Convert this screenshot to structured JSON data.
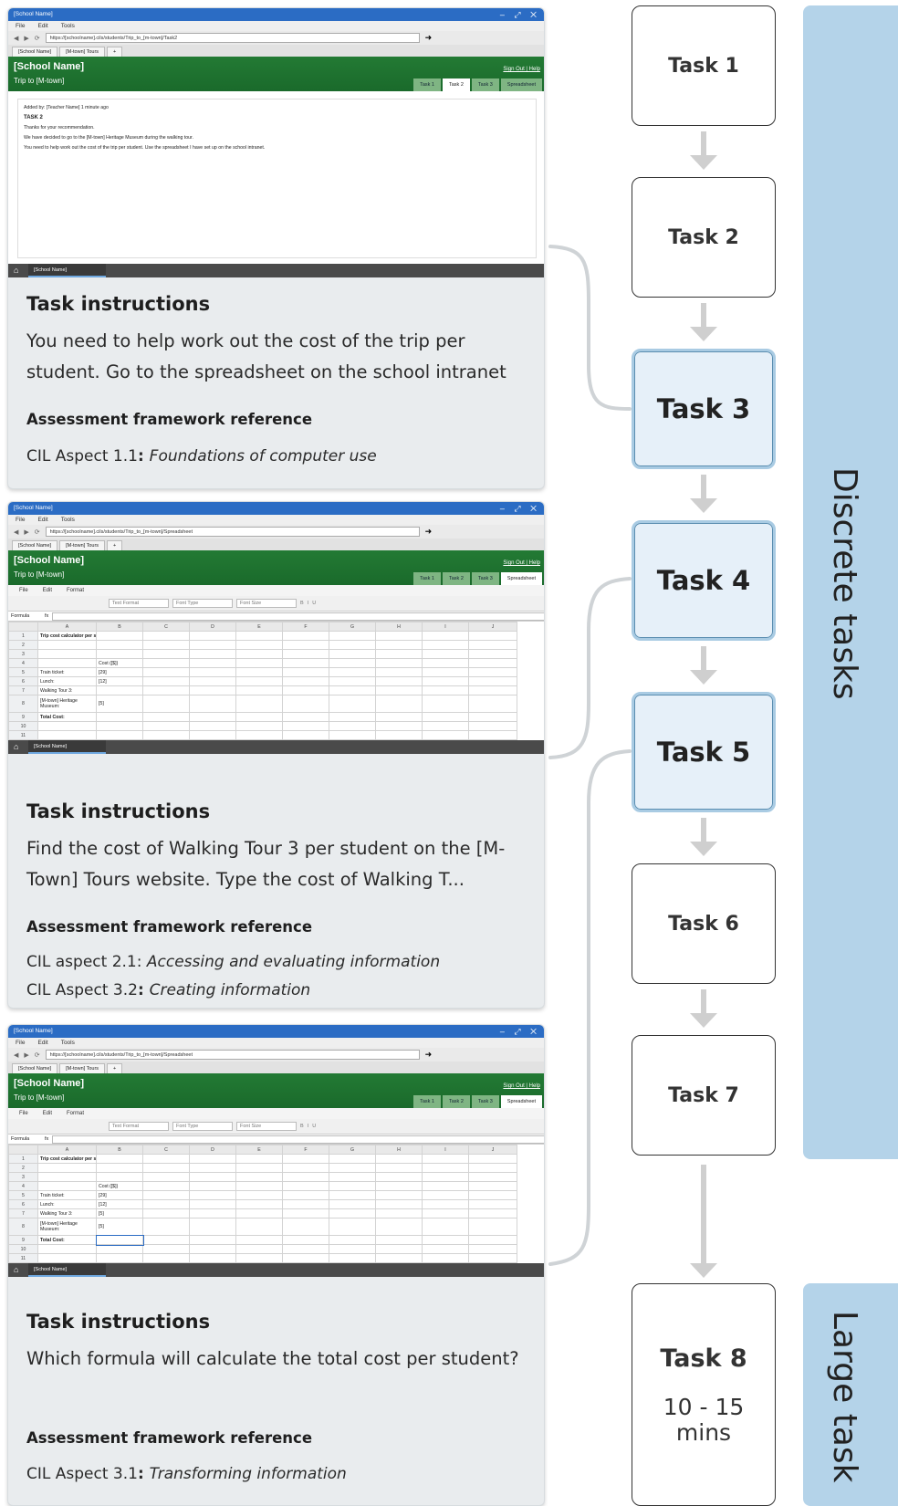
{
  "browser": {
    "window_title": "[School Name]",
    "window_controls": "– ⤢ ✕",
    "menu": [
      "File",
      "Edit",
      "Tools"
    ],
    "url_task2": "https://[schoolname].cils/students/Trip_to_[m-town]/Task2",
    "url_sheet": "https://[schoolname].cils/students/Trip_to_[m-town]/Spreadsheet",
    "tabs": [
      "[School Name]",
      "[M-town] Tours",
      "+"
    ],
    "bottom_tab": "[School Name]"
  },
  "site": {
    "name": "[School Name]",
    "page": "Trip to [M-town]",
    "signout": "Sign Out | Help",
    "tabs": [
      "Task 1",
      "Task 2",
      "Task 3",
      "Spreadsheet"
    ]
  },
  "message": {
    "added": "Added by: [Teacher Name] 1 minute ago",
    "title": "TASK 2",
    "lines": [
      "Thanks for your recommendation.",
      "We have decided to go to the [M-town] Heritage Museum during the walking tour.",
      "You need to help work out the cost of the trip per student. Use the spreadsheet I have set up on the school intranet."
    ]
  },
  "sheet": {
    "menu": [
      "File",
      "Edit",
      "Format"
    ],
    "dropdowns": [
      "Text Format",
      "Font Type",
      "Font Size"
    ],
    "formula_label": "Formula",
    "fx": "fx",
    "columns": [
      "",
      "A",
      "B",
      "C",
      "D",
      "E",
      "F",
      "G",
      "H",
      "I",
      "J"
    ],
    "rows_card2": [
      [
        "1",
        "Trip cost calculator per student",
        ""
      ],
      [
        "2",
        "",
        ""
      ],
      [
        "3",
        "",
        ""
      ],
      [
        "4",
        "",
        "Cost ([$])"
      ],
      [
        "5",
        "Train ticket:",
        "[29]"
      ],
      [
        "6",
        "Lunch:",
        "[12]"
      ],
      [
        "7",
        "Walking Tour 3:",
        ""
      ],
      [
        "8",
        "[M-town] Heritage Museum:",
        "[5]"
      ],
      [
        "9",
        "Total Cost:",
        ""
      ],
      [
        "10",
        "",
        ""
      ],
      [
        "11",
        "",
        ""
      ]
    ],
    "rows_card3": [
      [
        "1",
        "Trip cost calculator per student",
        ""
      ],
      [
        "2",
        "",
        ""
      ],
      [
        "3",
        "",
        ""
      ],
      [
        "4",
        "",
        "Cost ([$])"
      ],
      [
        "5",
        "Train ticket:",
        "[29]"
      ],
      [
        "6",
        "Lunch:",
        "[12]"
      ],
      [
        "7",
        "Walking Tour 3:",
        "[5]"
      ],
      [
        "8",
        "[M-town] Heritage Museum:",
        "[5]"
      ],
      [
        "9",
        "Total Cost:",
        ""
      ],
      [
        "10",
        "",
        ""
      ],
      [
        "11",
        "",
        ""
      ]
    ]
  },
  "cards": [
    {
      "heading": "Task instructions",
      "text": "You need to help work out the cost of the trip per student. Go to the spreadsheet on the school intranet",
      "ref_heading": "Assessment framework reference",
      "refs": [
        {
          "prefix": "CIL Aspect 1.1",
          "sep": ": ",
          "title": "Foundations of computer use"
        }
      ]
    },
    {
      "heading": "Task instructions",
      "text": "Find the cost of Walking Tour 3 per student on the [M-Town] Tours website. Type the cost of Walking T...",
      "ref_heading": "Assessment framework reference",
      "refs": [
        {
          "prefix": "CIL aspect 2.1",
          "sep": ": ",
          "title": "Accessing and evaluating information"
        },
        {
          "prefix": "CIL Aspect 3.2",
          "sep": ": ",
          "title": "Creating information"
        }
      ]
    },
    {
      "heading": "Task instructions",
      "text": "Which formula will calculate the total cost per student?",
      "ref_heading": "Assessment framework reference",
      "refs": [
        {
          "prefix": "CIL Aspect 3.1",
          "sep": ": ",
          "title": "Transforming information"
        }
      ]
    }
  ],
  "tasks": [
    {
      "label": "Task 1",
      "highlight": false
    },
    {
      "label": "Task 2",
      "highlight": false
    },
    {
      "label": "Task 3",
      "highlight": true
    },
    {
      "label": "Task 4",
      "highlight": true
    },
    {
      "label": "Task 5",
      "highlight": true
    },
    {
      "label": "Task 6",
      "highlight": false
    },
    {
      "label": "Task 7",
      "highlight": false
    },
    {
      "label": "Task 8",
      "highlight": false,
      "sub": "10 - 15 mins"
    }
  ],
  "bands": {
    "discrete": "Discrete tasks",
    "large": "Large task"
  },
  "colors": {
    "accent_blue": "#b4d3e9",
    "highlight_fill": "#e6f0f9",
    "site_green": "#237a34",
    "titlebar_blue": "#2b6cc4"
  }
}
